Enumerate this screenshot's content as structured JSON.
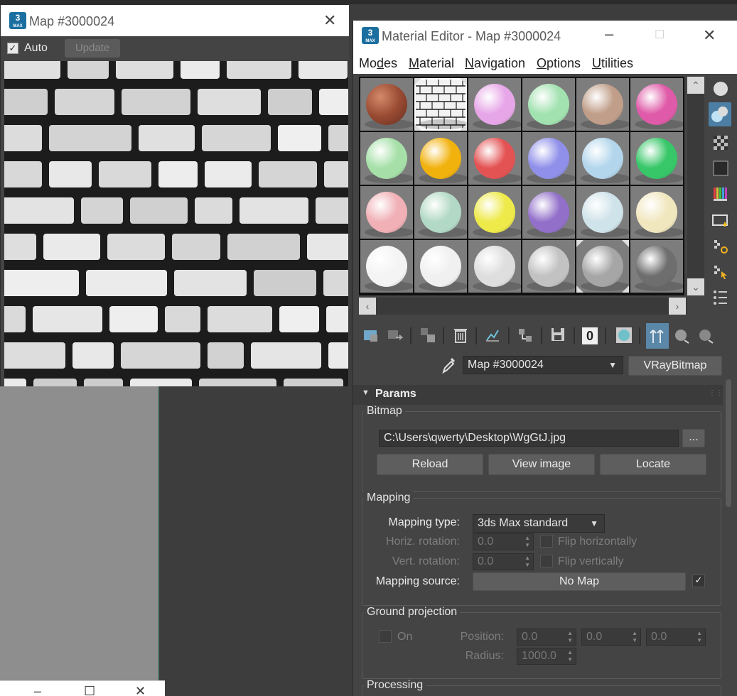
{
  "map_window": {
    "title": "Map #3000024",
    "close_glyph": "✕",
    "auto_label": "Auto",
    "auto_checked": true,
    "update_label": "Update",
    "image_alt": "brick-wall-texture"
  },
  "material_editor": {
    "title": "Material Editor - Map #3000024",
    "menu": [
      "Modes",
      "Material",
      "Navigation",
      "Options",
      "Utilities"
    ],
    "slots": [
      "#9a4b33",
      "brick-map",
      "#e7a6e8",
      "#a2e2b0",
      "#c09e89",
      "#df5aa8",
      "#a6e0a8",
      "#f2b20d",
      "#e45354",
      "#9090ea",
      "#b3d6ec",
      "#37c768",
      "#f0b0b6",
      "#b2d9c5",
      "#eeea4a",
      "#9270c9",
      "#cfe3ea",
      "#f1e7bf",
      "#f4f4f4",
      "#f0f0f0",
      "#dedede",
      "#c2c2c2",
      "#a6a6a6",
      "#6e6e6e"
    ],
    "map_name": "Map #3000024",
    "map_type_button": "VRayBitmap",
    "zero_label": "0",
    "params": {
      "rollout_title": "Params",
      "bitmap_group": "Bitmap",
      "bitmap_path": "C:\\Users\\qwerty\\Desktop\\WgGtJ.jpg",
      "browse_label": "...",
      "reload_label": "Reload",
      "view_image_label": "View image",
      "locate_label": "Locate",
      "mapping_group": "Mapping",
      "mapping_type_label": "Mapping type:",
      "mapping_type_value": "3ds Max standard",
      "horiz_rotation_label": "Horiz. rotation:",
      "horiz_rotation_value": "0.0",
      "flip_horizontally_label": "Flip horizontally",
      "vert_rotation_label": "Vert. rotation:",
      "vert_rotation_value": "0.0",
      "flip_vertically_label": "Flip vertically",
      "mapping_source_label": "Mapping source:",
      "mapping_source_value": "No Map",
      "ground_group": "Ground projection",
      "on_label": "On",
      "position_label": "Position:",
      "position_x": "0.0",
      "position_y": "0.0",
      "position_z": "0.0",
      "radius_label": "Radius:",
      "radius_value": "1000.0",
      "processing_group": "Processing"
    }
  },
  "colors": {
    "panel_bg": "#444444",
    "title_bg": "#ffffff",
    "accent_blue": "#1b6fa0"
  }
}
